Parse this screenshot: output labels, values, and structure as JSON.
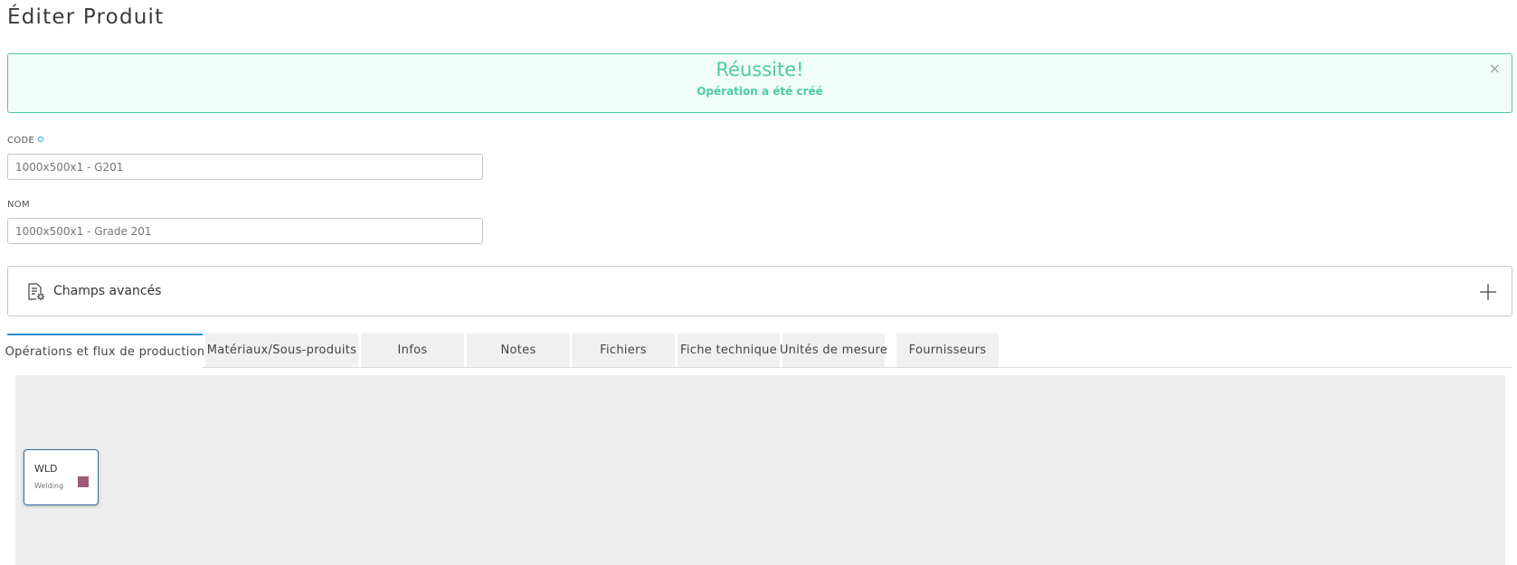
{
  "page": {
    "title": "Éditer Produit"
  },
  "alert": {
    "title": "Réussite!",
    "message": "Opération a été créé",
    "close": "×"
  },
  "form": {
    "code": {
      "label": "CODE",
      "value": "1000x500x1 - G201"
    },
    "name": {
      "label": "NOM",
      "value": "1000x500x1 - Grade 201"
    }
  },
  "advanced": {
    "label": "Champs avancés",
    "icon": "document-settings-icon",
    "toggle_icon": "plus-icon"
  },
  "tabs": [
    {
      "label": "Opérations et flux de production",
      "active": true
    },
    {
      "label": "Matériaux/Sous-produits",
      "active": false
    },
    {
      "label": "Infos",
      "active": false
    },
    {
      "label": "Notes",
      "active": false
    },
    {
      "label": "Fichiers",
      "active": false
    },
    {
      "label": "Fiche technique",
      "active": false
    },
    {
      "label": "Unités de mesure",
      "active": false
    },
    {
      "label": "Fournisseurs",
      "active": false
    }
  ],
  "flow": {
    "nodes": [
      {
        "code": "WLD",
        "name": "Welding",
        "color": "#a05a78"
      }
    ]
  },
  "colors": {
    "success": "#4ecba6",
    "active_tab_accent": "#2a8fd6",
    "required_dot": "#2a9fd6"
  }
}
